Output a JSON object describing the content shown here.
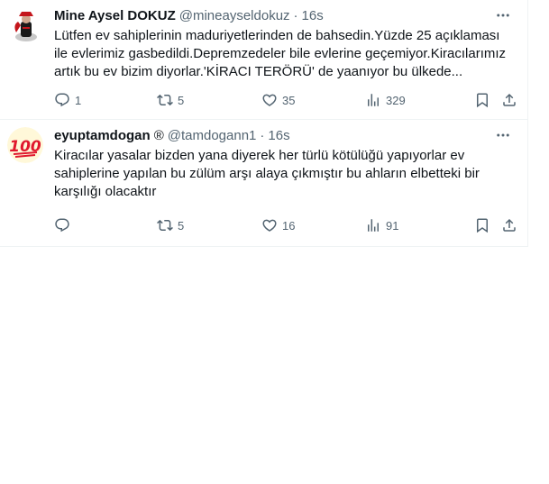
{
  "tweets": [
    {
      "name": "Mine Aysel DOKUZ",
      "verified_badge": "",
      "handle": "@mineayseldokuz",
      "time": "16s",
      "text_lines": [
        "Lütfen ev sahiplerinin maduriyetlerinden de bahsedin.Yüzde 25 açıklaması",
        "ile evlerimiz gasbedildi.Depremzedeler bile evlerine geçemiyor.Kiracılarımız",
        "artık bu ev bizim diyorlar.'KİRACI TERÖRÜ' de yaanıyor bu ülkede..."
      ],
      "replies": "1",
      "retweets": "5",
      "likes": "35",
      "views": "329"
    },
    {
      "name": "eyuptamdogan",
      "verified_badge": "®",
      "handle": "@tamdogann1",
      "time": "16s",
      "text_lines": [
        "Kiracılar yasalar bizden yana diyerek her türlü kötülüğü yapıyorlar ev",
        "sahiplerine yapılan bu zülüm arşı alaya çıkmıştır bu ahların elbetteki bir",
        "karşılığı olacaktır"
      ],
      "replies": "",
      "retweets": "5",
      "likes": "16",
      "views": "91"
    }
  ],
  "avatar2_glyph": "100",
  "colors": {
    "text": "#0f1419",
    "muted": "#536471",
    "border": "#eff3f4",
    "emoji_red": "#e0182d"
  },
  "icons": [
    "reply-icon",
    "retweet-icon",
    "like-icon",
    "views-icon",
    "bookmark-icon",
    "share-icon",
    "more-icon"
  ]
}
